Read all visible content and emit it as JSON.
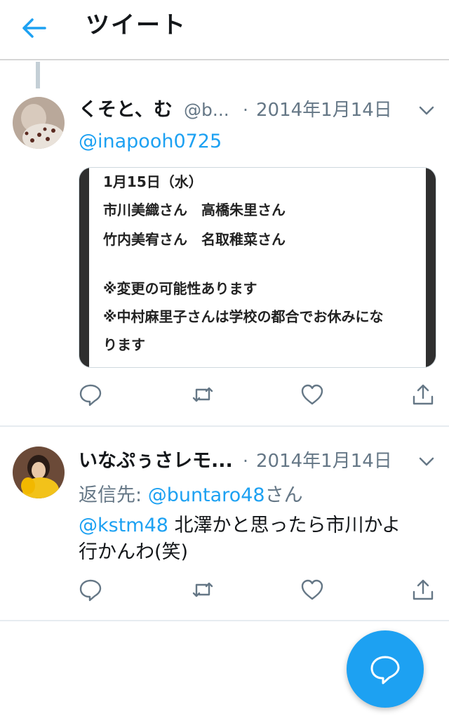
{
  "header": {
    "title": "ツイート",
    "back_icon": "back-arrow-icon"
  },
  "tweets": [
    {
      "name": "くそと、む",
      "handle": "@b...",
      "date": "2014年1月14日",
      "mention": "@inapooh0725",
      "media_lines": [
        "1月15日（水）",
        "市川美織さん　高橋朱里さん",
        "竹内美宥さん　名取稚菜さん",
        "",
        "※変更の可能性あります",
        "※中村麻里子さんは学校の都合でお休みにな",
        "ります"
      ]
    },
    {
      "name": "いなぷぅさレモ...",
      "date": "2014年1月14日",
      "reply_prefix": "返信先: ",
      "reply_handle": "@buntaro48",
      "reply_suffix": "さん",
      "body_mention": "@kstm48",
      "body_line1": " 北澤かと思ったら市川かよ",
      "body_line2": "行かんわ(笑)"
    }
  ],
  "dot": "·",
  "colors": {
    "accent": "#1da1f2",
    "muted": "#657786",
    "icon": "#657786"
  },
  "icons": [
    "reply-icon",
    "retweet-icon",
    "like-icon",
    "share-icon",
    "compose-reply-icon",
    "chevron-down-icon"
  ]
}
